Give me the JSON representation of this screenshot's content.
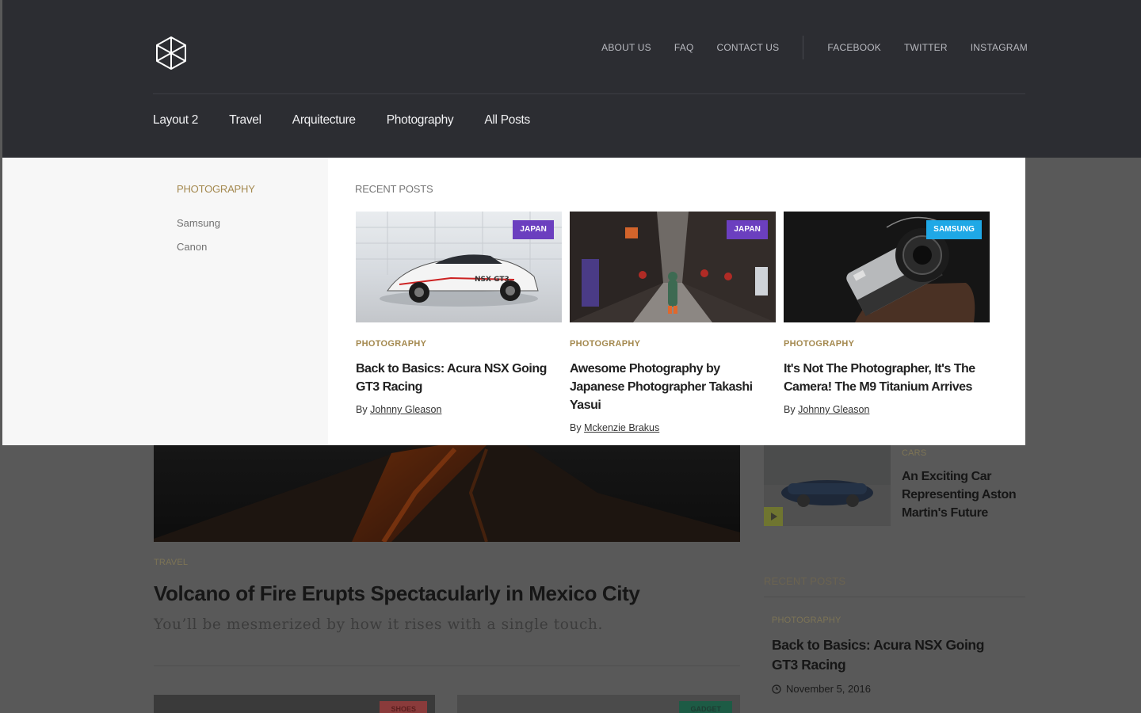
{
  "header": {
    "top_links": [
      "ABOUT US",
      "FAQ",
      "CONTACT US"
    ],
    "social_links": [
      "FACEBOOK",
      "TWITTER",
      "INSTAGRAM"
    ],
    "nav": [
      "Layout 2",
      "Travel",
      "Arquitecture",
      "Photography",
      "All Posts"
    ],
    "logo_icon": "hexagon-cube-icon"
  },
  "mega_menu": {
    "category_title": "PHOTOGRAPHY",
    "subcategories": [
      "Samsung",
      "Canon"
    ],
    "recent_heading": "RECENT POSTS",
    "posts": [
      {
        "badge": "JAPAN",
        "badge_color": "#6b3fbf",
        "category": "PHOTOGRAPHY",
        "title": "Back to Basics: Acura NSX Going GT3 Racing",
        "by": "By",
        "author": "Johnny Gleason"
      },
      {
        "badge": "JAPAN",
        "badge_color": "#6b3fbf",
        "category": "PHOTOGRAPHY",
        "title": "Awesome Photography by Japanese Photographer Takashi Yasui",
        "by": "By",
        "author": "Mckenzie Brakus"
      },
      {
        "badge": "SAMSUNG",
        "badge_color": "#1fa8e6",
        "category": "PHOTOGRAPHY",
        "title": "It's Not The Photographer, It's The Camera! The M9 Titanium Arrives",
        "by": "By",
        "author": "Johnny Gleason"
      }
    ]
  },
  "background": {
    "feature": {
      "category": "TRAVEL",
      "title": "Volcano of Fire Erupts Spectacularly in Mexico City",
      "subtitle": "You’ll be mesmerized by how it rises with a single touch."
    },
    "sidebar_post": {
      "category": "CARS",
      "title": "An Exciting Car Representing Aston Martin's Future"
    },
    "recent_heading": "RECENT POSTS",
    "recent_post": {
      "category": "PHOTOGRAPHY",
      "title": "Back to Basics: Acura NSX Going GT3 Racing",
      "date": "November 5, 2016"
    },
    "bottom_badges": [
      "SHOES",
      "GADGET"
    ]
  },
  "colors": {
    "accent": "#a4894f",
    "header_bg": "#2c2d32",
    "purple": "#6b3fbf",
    "blue": "#1fa8e6"
  }
}
